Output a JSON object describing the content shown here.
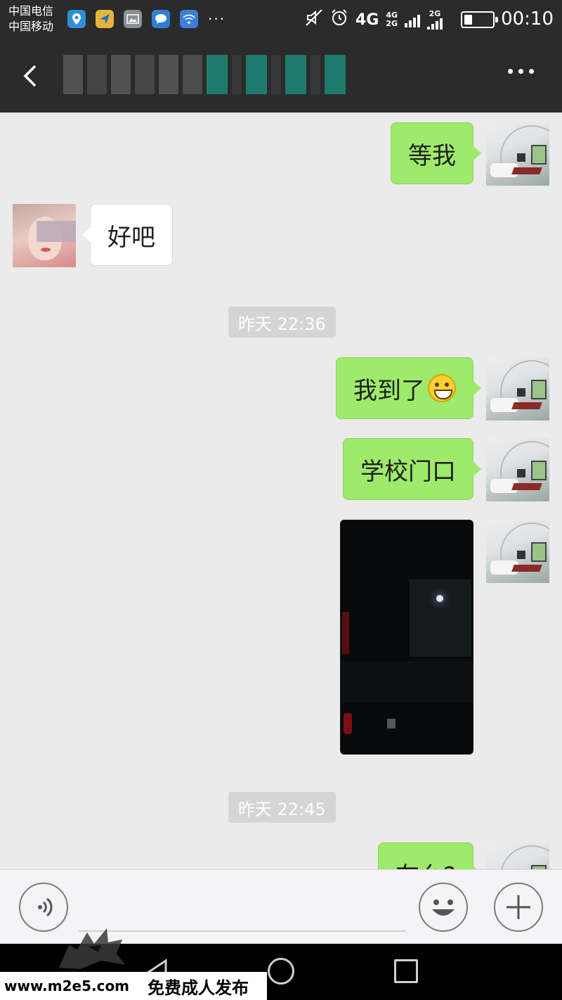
{
  "status_bar": {
    "carrier_1": "中国电信",
    "carrier_2": "中国移动",
    "more_notifications": "···",
    "net_4g": "4G",
    "net_small_4g": "4G",
    "net_small_2g": "2G",
    "net_2g_label": "2G",
    "battery_level_fraction": 0.3,
    "time": "00:10"
  },
  "title_bar": {
    "back_icon": "chevron-left-icon",
    "more_icon": "more-dots-icon"
  },
  "messages": [
    {
      "side": "out",
      "text": "等我"
    },
    {
      "side": "in",
      "text": "好吧"
    },
    {
      "type": "time",
      "text": "昨天 22:36"
    },
    {
      "side": "out",
      "text": "我到了",
      "emoji": "grinning-face-emoji"
    },
    {
      "side": "out",
      "text": "学校门口"
    },
    {
      "side": "out",
      "type": "image",
      "description_icon": "photo-message"
    },
    {
      "type": "time",
      "text": "昨天 22:45"
    },
    {
      "side": "out",
      "text": "在么?"
    }
  ],
  "input_bar": {
    "voice_icon": "voice-icon",
    "emoji_icon": "smiley-icon",
    "plus_icon": "plus-icon"
  },
  "watermark": {
    "url": "www.m2e5.com",
    "text": "免费成人发布"
  },
  "colors": {
    "outgoing_bubble": "#9eea6a",
    "incoming_bubble": "#ffffff",
    "chat_background": "#ebebeb",
    "title_bar": "#2b2b2b"
  }
}
